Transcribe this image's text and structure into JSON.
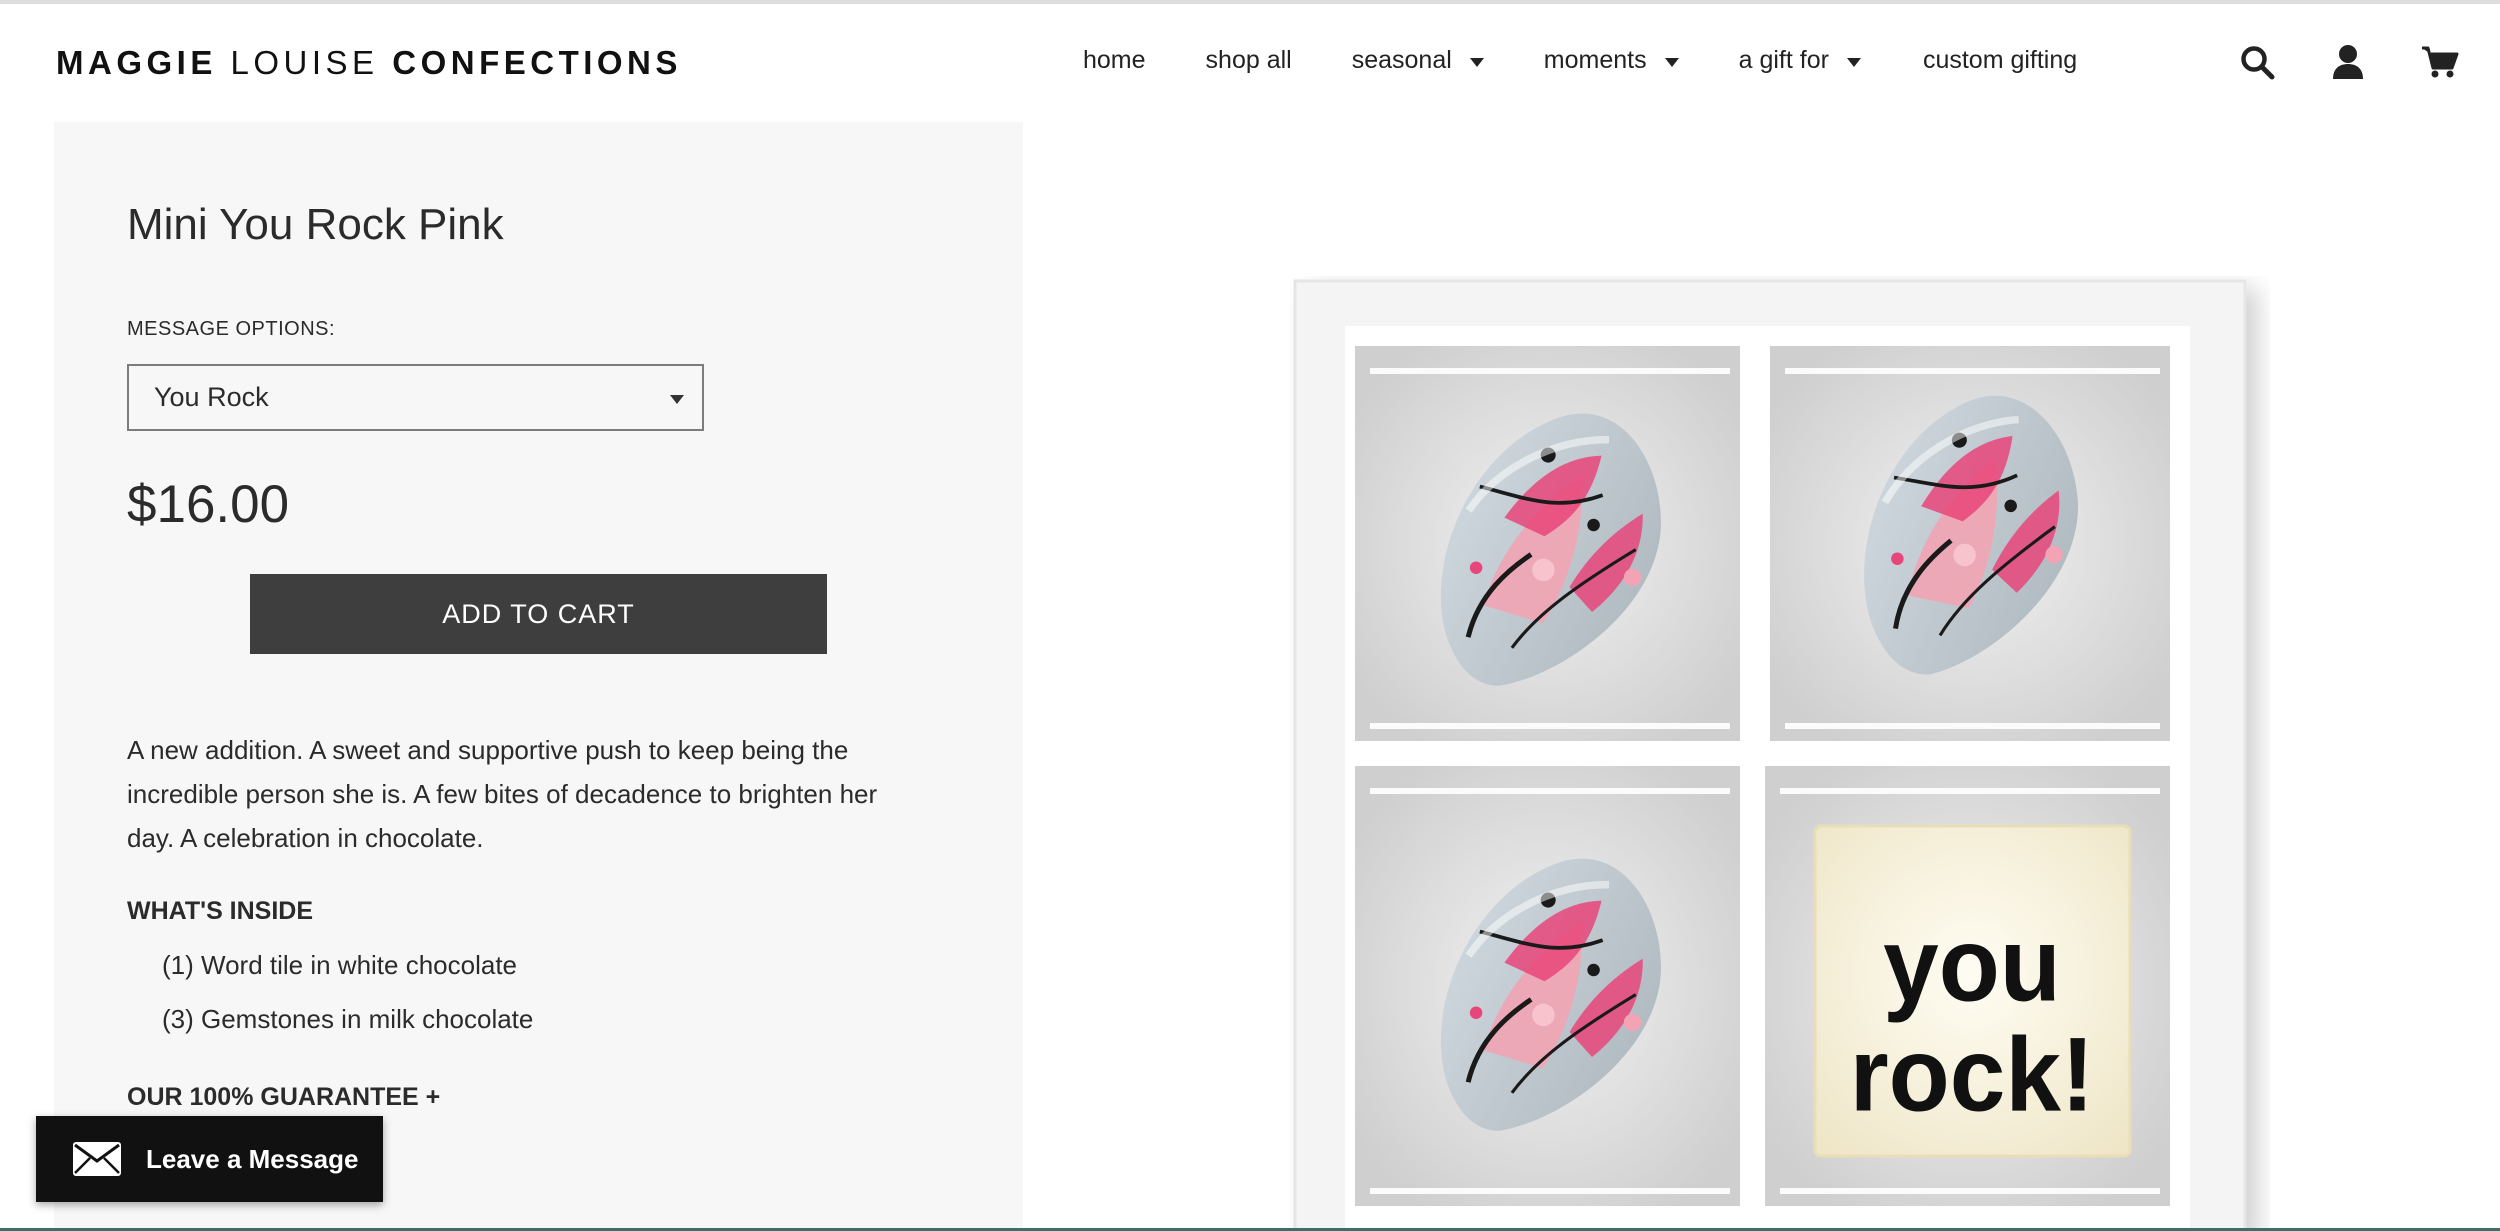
{
  "brand": {
    "logo_part1": "MAGGIE",
    "logo_part2": "LOUISE",
    "logo_part3": "CONFECTIONS"
  },
  "nav": {
    "items": [
      {
        "label": "home",
        "dropdown": false
      },
      {
        "label": "shop all",
        "dropdown": false
      },
      {
        "label": "seasonal",
        "dropdown": true
      },
      {
        "label": "moments",
        "dropdown": true
      },
      {
        "label": "a gift for",
        "dropdown": true
      },
      {
        "label": "custom gifting",
        "dropdown": false
      }
    ]
  },
  "header_icons": [
    "search-icon",
    "account-icon",
    "cart-icon"
  ],
  "product": {
    "title": "Mini You Rock Pink",
    "message_options_label": "MESSAGE OPTIONS:",
    "selected_message": "You Rock",
    "price": "$16.00",
    "add_to_cart_label": "ADD TO CART",
    "description": "A new addition. A sweet and supportive push to keep being the incredible person she is. A few bites of decadence to brighten her day. A celebration in chocolate.",
    "whats_inside_heading": "WHAT'S INSIDE",
    "whats_inside": [
      "(1) Word tile in white chocolate",
      "(3) Gemstones in milk chocolate"
    ],
    "guarantee_label": "OUR 100% GUARANTEE +",
    "image_tile_text_line1": "you",
    "image_tile_text_line2": "rock!"
  },
  "chat": {
    "leave_message_label": "Leave a Message"
  },
  "colors": {
    "button_bg": "#3e3e3e",
    "panel_bg": "#f7f7f7",
    "chat_bg": "#111111",
    "pink_accent": "#e8457a"
  }
}
